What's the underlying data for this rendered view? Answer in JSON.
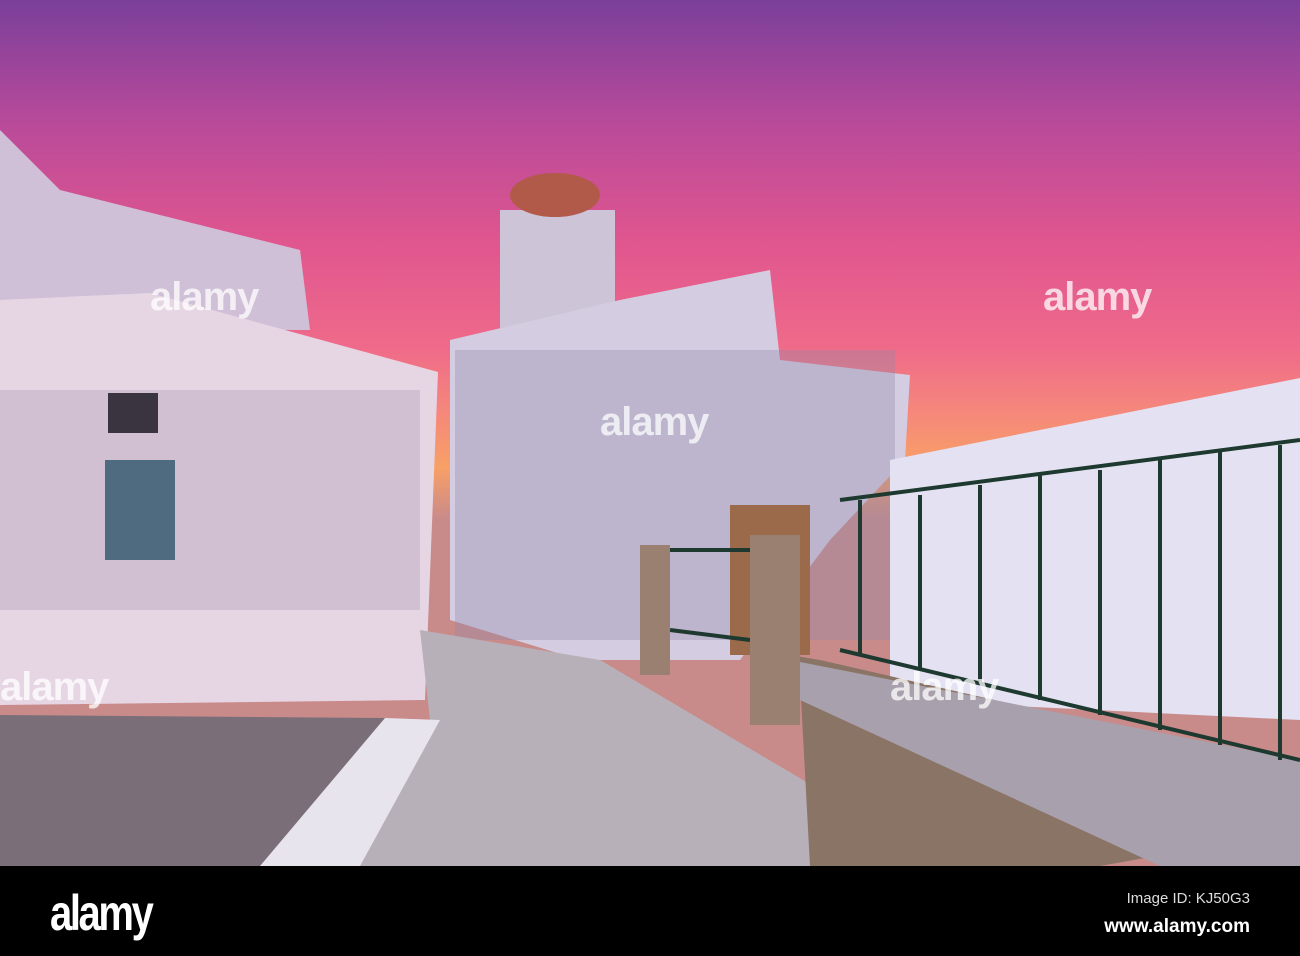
{
  "photo": {
    "subject": "Painted church at sunset",
    "watermark": "alamy",
    "colors": {
      "sky_top": "#7a3f9a",
      "sky_mid": "#e0568f",
      "horizon": "#f8a066",
      "wall": "#e8dce8",
      "fence": "#1e3a30"
    }
  },
  "footer": {
    "logo": "alamy",
    "image_id": "Image ID: KJ50G3",
    "url": "www.alamy.com"
  }
}
